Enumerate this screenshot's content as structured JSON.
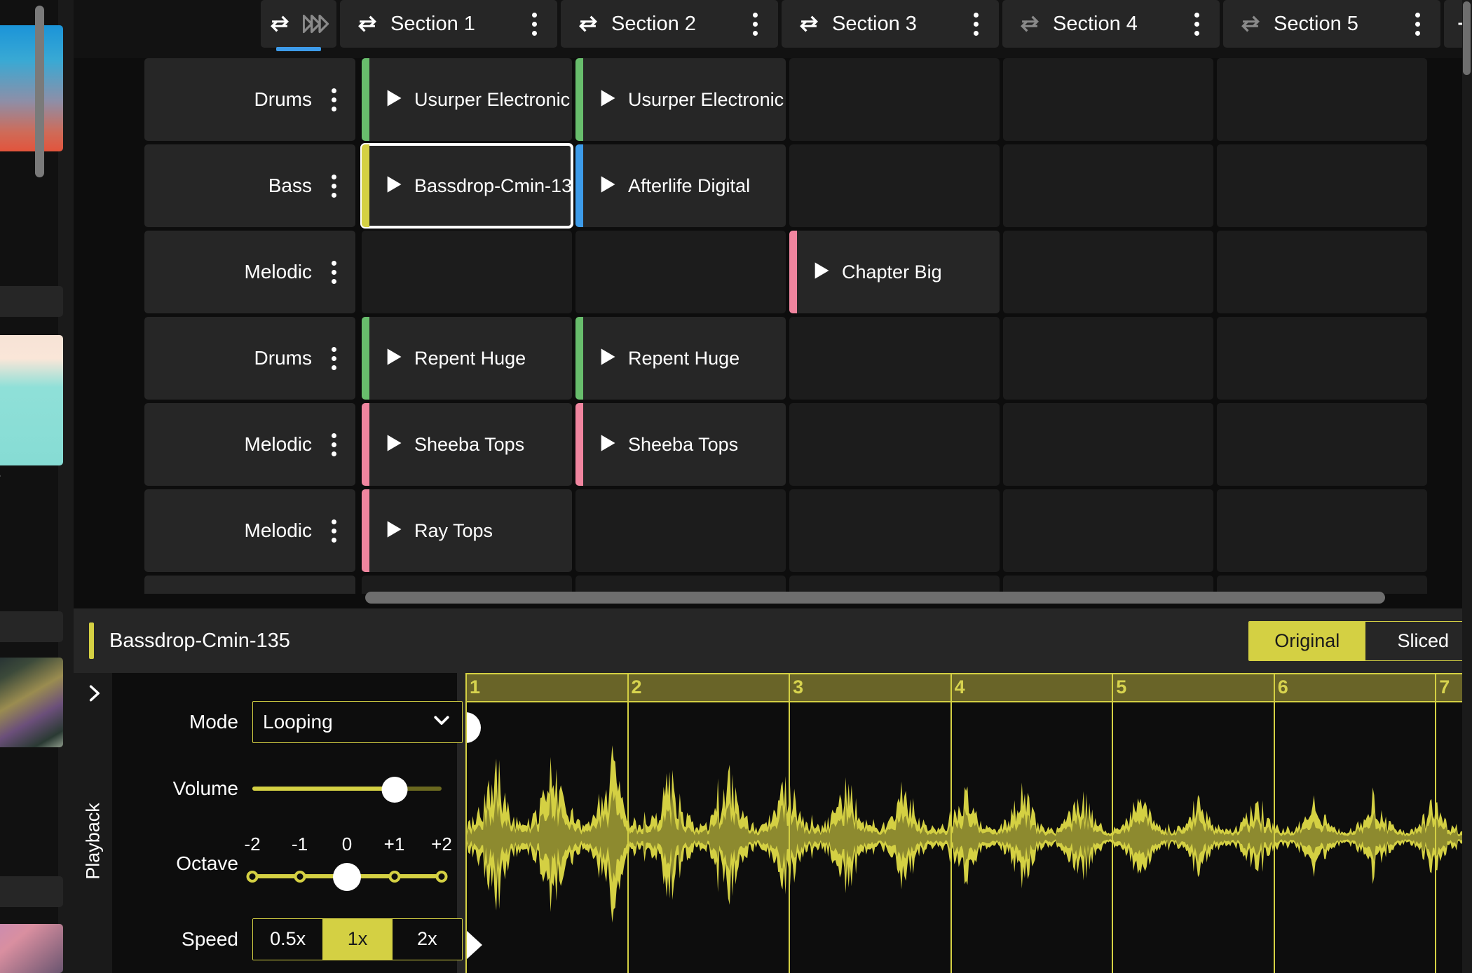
{
  "app": {
    "background": "#0d0d0d",
    "accent_yellow": "#d4d043",
    "accent_blue": "#3d9be9"
  },
  "left_sidebar": {
    "truncated_label": "e",
    "scrollbar": "vertical-scrollbar"
  },
  "tabbar": {
    "loop_toggle": {
      "name": "loop-toggle",
      "loop_icon": "loop-icon",
      "forward_icon": "fast-forward-icon",
      "active": true
    },
    "add_label": "+",
    "sections": [
      {
        "label": "Section 1",
        "loop_icon": "loop-icon",
        "loop_active": true,
        "menu_icon": "kebab-menu-icon"
      },
      {
        "label": "Section 2",
        "loop_icon": "loop-icon",
        "loop_active": true,
        "menu_icon": "kebab-menu-icon"
      },
      {
        "label": "Section 3",
        "loop_icon": "loop-icon",
        "loop_active": true,
        "menu_icon": "kebab-menu-icon"
      },
      {
        "label": "Section 4",
        "loop_icon": "loop-icon",
        "loop_active": false,
        "menu_icon": "kebab-menu-icon"
      },
      {
        "label": "Section 5",
        "loop_icon": "loop-icon",
        "loop_active": false,
        "menu_icon": "kebab-menu-icon"
      }
    ]
  },
  "grid": {
    "tracks": [
      {
        "name": "Drums",
        "menu_icon": "kebab-menu-icon"
      },
      {
        "name": "Bass",
        "menu_icon": "kebab-menu-icon"
      },
      {
        "name": "Melodic",
        "menu_icon": "kebab-menu-icon"
      },
      {
        "name": "Drums",
        "menu_icon": "kebab-menu-icon"
      },
      {
        "name": "Melodic",
        "menu_icon": "kebab-menu-icon"
      },
      {
        "name": "Melodic",
        "menu_icon": "kebab-menu-icon"
      }
    ],
    "clip_colors": {
      "green": "#68bd6c",
      "yellow": "#d4d043",
      "blue": "#3d9be9",
      "pink": "#f0859f"
    },
    "rows": [
      {
        "track": "Drums",
        "cells": [
          {
            "label": "Usurper Electronic",
            "color": "#68bd6c",
            "selected": false,
            "empty": false
          },
          {
            "label": "Usurper Electronic",
            "color": "#68bd6c",
            "selected": false,
            "empty": false
          },
          {
            "label": "",
            "color": "",
            "selected": false,
            "empty": true
          },
          {
            "label": "",
            "color": "",
            "selected": false,
            "empty": true
          },
          {
            "label": "",
            "color": "",
            "selected": false,
            "empty": true
          }
        ]
      },
      {
        "track": "Bass",
        "cells": [
          {
            "label": "Bassdrop-Cmin-13",
            "color": "#d4d043",
            "selected": true,
            "empty": false
          },
          {
            "label": "Afterlife Digital",
            "color": "#3d9be9",
            "selected": false,
            "empty": false
          },
          {
            "label": "",
            "color": "",
            "selected": false,
            "empty": true
          },
          {
            "label": "",
            "color": "",
            "selected": false,
            "empty": true
          },
          {
            "label": "",
            "color": "",
            "selected": false,
            "empty": true
          }
        ]
      },
      {
        "track": "Melodic",
        "cells": [
          {
            "label": "",
            "color": "",
            "selected": false,
            "empty": true
          },
          {
            "label": "",
            "color": "",
            "selected": false,
            "empty": true
          },
          {
            "label": "Chapter Big",
            "color": "#f0859f",
            "selected": false,
            "empty": false
          },
          {
            "label": "",
            "color": "",
            "selected": false,
            "empty": true
          },
          {
            "label": "",
            "color": "",
            "selected": false,
            "empty": true
          }
        ]
      },
      {
        "track": "Drums",
        "cells": [
          {
            "label": "Repent Huge",
            "color": "#68bd6c",
            "selected": false,
            "empty": false
          },
          {
            "label": "Repent Huge",
            "color": "#68bd6c",
            "selected": false,
            "empty": false
          },
          {
            "label": "",
            "color": "",
            "selected": false,
            "empty": true
          },
          {
            "label": "",
            "color": "",
            "selected": false,
            "empty": true
          },
          {
            "label": "",
            "color": "",
            "selected": false,
            "empty": true
          }
        ]
      },
      {
        "track": "Melodic",
        "cells": [
          {
            "label": "Sheeba Tops",
            "color": "#f0859f",
            "selected": false,
            "empty": false
          },
          {
            "label": "Sheeba Tops",
            "color": "#f0859f",
            "selected": false,
            "empty": false
          },
          {
            "label": "",
            "color": "",
            "selected": false,
            "empty": true
          },
          {
            "label": "",
            "color": "",
            "selected": false,
            "empty": true
          },
          {
            "label": "",
            "color": "",
            "selected": false,
            "empty": true
          }
        ]
      },
      {
        "track": "Melodic",
        "cells": [
          {
            "label": "Ray Tops",
            "color": "#f0859f",
            "selected": false,
            "empty": false
          },
          {
            "label": "",
            "color": "",
            "selected": false,
            "empty": true
          },
          {
            "label": "",
            "color": "",
            "selected": false,
            "empty": true
          },
          {
            "label": "",
            "color": "",
            "selected": false,
            "empty": true
          },
          {
            "label": "",
            "color": "",
            "selected": false,
            "empty": true
          }
        ]
      }
    ]
  },
  "editor": {
    "clip_title": "Bassdrop-Cmin-135",
    "view_toggle": {
      "options": [
        "Original",
        "Sliced"
      ],
      "selected": "Original"
    },
    "playback": {
      "group_label": "Playback",
      "collapse_icon": "chevron-right-icon",
      "mode": {
        "label": "Mode",
        "value": "Looping",
        "chevron_icon": "chevron-down-icon"
      },
      "volume": {
        "label": "Volume",
        "value": 75,
        "min": 0,
        "max": 100
      },
      "octave": {
        "label": "Octave",
        "ticks": [
          "-2",
          "-1",
          "0",
          "+1",
          "+2"
        ],
        "value": "0",
        "value_index": 2
      },
      "speed": {
        "label": "Speed",
        "options": [
          "0.5x",
          "1x",
          "2x"
        ],
        "selected": "1x"
      }
    },
    "waveform": {
      "ruler_marks": [
        "1",
        "2",
        "3",
        "4",
        "5",
        "6",
        "7"
      ],
      "color": "#d4d043",
      "start_handle_icon": "start-handle-icon",
      "end_handle_icon": "end-handle-icon",
      "loop_marker_icon": "loop-marker-icon"
    }
  }
}
